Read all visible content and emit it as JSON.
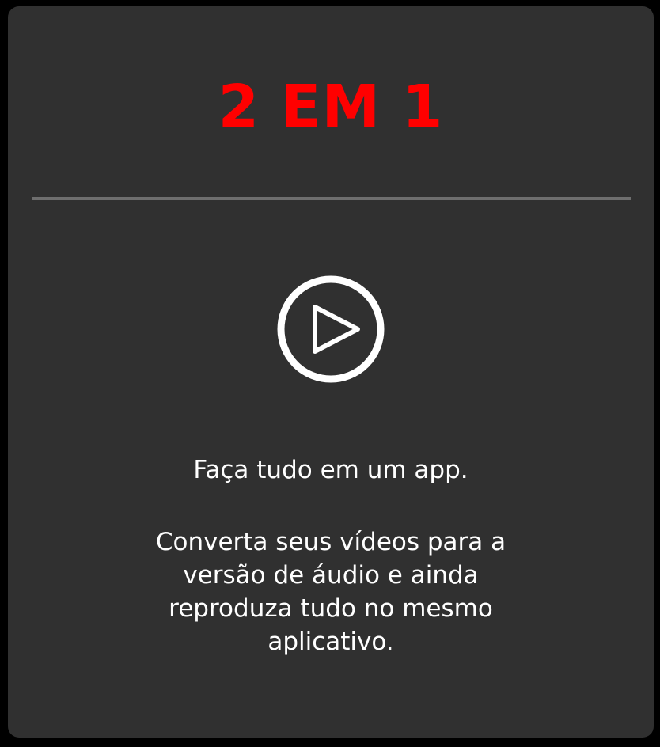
{
  "card": {
    "title": "2 EM 1",
    "title_color": "#ff0000",
    "icon": "play-circle-icon",
    "tagline": "Faça tudo em um app.",
    "description": "Converta seus vídeos para a versão de áudio e ainda reproduza tudo no mesmo aplicativo."
  }
}
